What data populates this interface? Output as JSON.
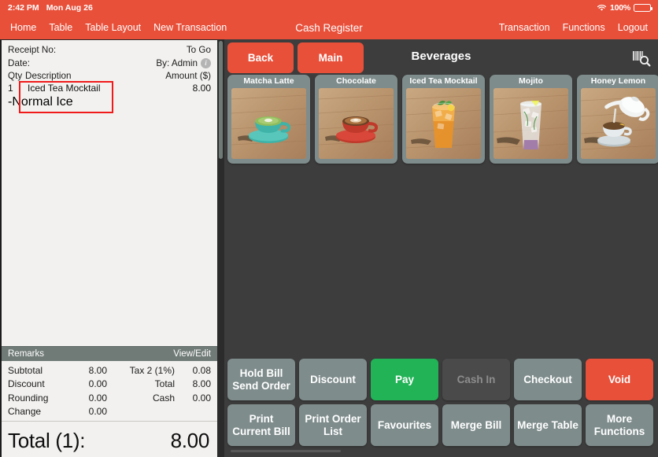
{
  "status_bar": {
    "time": "2:42 PM",
    "date": "Mon Aug 26",
    "wifi_icon": "wifi-icon",
    "battery_percent": "100%",
    "battery_icon": "battery-full-icon"
  },
  "nav": {
    "title": "Cash Register",
    "left_items": [
      {
        "label": "Home",
        "name": "nav-home"
      },
      {
        "label": "Table",
        "name": "nav-table"
      },
      {
        "label": "Table Layout",
        "name": "nav-table-layout"
      },
      {
        "label": "New Transaction",
        "name": "nav-new-transaction"
      }
    ],
    "right_items": [
      {
        "label": "Transaction",
        "name": "nav-transaction"
      },
      {
        "label": "Functions",
        "name": "nav-functions"
      },
      {
        "label": "Logout",
        "name": "nav-logout"
      }
    ]
  },
  "receipt": {
    "receipt_no_label": "Receipt No:",
    "receipt_no_value": "",
    "order_type": "To Go",
    "date_label": "Date:",
    "date_value": "",
    "by_label": "By: Admin",
    "info_icon": "info-icon",
    "columns": {
      "qty": "Qty",
      "description": "Description",
      "amount": "Amount ($)"
    },
    "items": [
      {
        "qty": "1",
        "description": "Iced Tea Mocktail",
        "modifier": "-Normal Ice",
        "amount": "8.00",
        "highlighted": true
      }
    ],
    "remarks_label": "Remarks",
    "view_edit_label": "View/Edit",
    "totals": [
      {
        "label1": "Subtotal",
        "value1": "8.00",
        "label2": "Tax 2 (1%)",
        "value2": "0.08"
      },
      {
        "label1": "Discount",
        "value1": "0.00",
        "label2": "Total",
        "value2": "8.00"
      },
      {
        "label1": "Rounding",
        "value1": "0.00",
        "label2": "Cash",
        "value2": "0.00"
      },
      {
        "label1": "Change",
        "value1": "0.00",
        "label2": "",
        "value2": ""
      }
    ],
    "grand_total_label": "Total (1):",
    "grand_total_value": "8.00"
  },
  "catalog": {
    "back_label": "Back",
    "main_label": "Main",
    "category_title": "Beverages",
    "barcode_icon": "barcode-search-icon",
    "products": [
      {
        "name": "Matcha Latte",
        "image": "matcha-latte-cup"
      },
      {
        "name": "Chocolate",
        "image": "hot-chocolate-cup"
      },
      {
        "name": "Iced Tea Mocktail",
        "image": "iced-tea-glass"
      },
      {
        "name": "Mojito",
        "image": "mojito-glass"
      },
      {
        "name": "Honey Lemon",
        "image": "honey-lemon-teapot"
      }
    ]
  },
  "actions": {
    "row1": [
      {
        "label": "Hold Bill\nSend Order",
        "name": "hold-bill-send-order-button",
        "style": "default",
        "disabled": false
      },
      {
        "label": "Discount",
        "name": "discount-button",
        "style": "default",
        "disabled": false
      },
      {
        "label": "Pay",
        "name": "pay-button",
        "style": "green",
        "disabled": false
      },
      {
        "label": "Cash In",
        "name": "cash-in-button",
        "style": "disabled",
        "disabled": true
      },
      {
        "label": "Checkout",
        "name": "checkout-button",
        "style": "default",
        "disabled": false
      },
      {
        "label": "Void",
        "name": "void-button",
        "style": "red",
        "disabled": false
      }
    ],
    "row2": [
      {
        "label": "Print\nCurrent Bill",
        "name": "print-current-bill-button",
        "style": "default",
        "disabled": false
      },
      {
        "label": "Print Order\nList",
        "name": "print-order-list-button",
        "style": "default",
        "disabled": false
      },
      {
        "label": "Favourites",
        "name": "favourites-button",
        "style": "default",
        "disabled": false
      },
      {
        "label": "Merge Bill",
        "name": "merge-bill-button",
        "style": "default",
        "disabled": false
      },
      {
        "label": "Merge Table",
        "name": "merge-table-button",
        "style": "default",
        "disabled": false
      },
      {
        "label": "More\nFunctions",
        "name": "more-functions-button",
        "style": "default",
        "disabled": false
      }
    ]
  },
  "colors": {
    "brand_red": "#e8503a",
    "pay_green": "#22b357",
    "button_gray": "#7f8c8c",
    "panel_dark": "#3d3d3d",
    "receipt_bg": "#f2f1ef",
    "annotation_red": "#f01a1a"
  }
}
